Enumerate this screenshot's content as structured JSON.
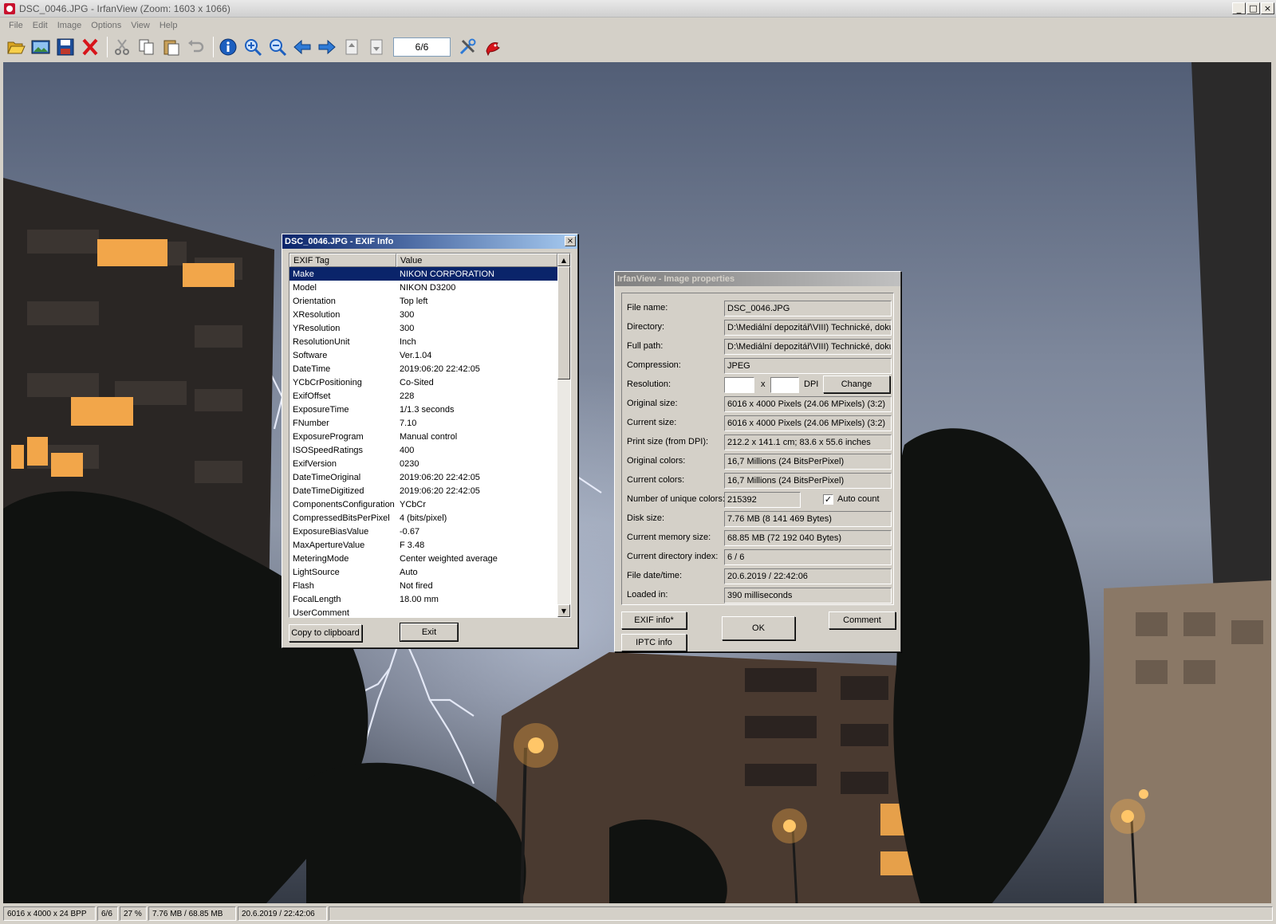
{
  "window": {
    "title": "DSC_0046.JPG - IrfanView (Zoom: 1603 x 1066)",
    "minimize": "_",
    "maximize": "□",
    "close": "×"
  },
  "menu": [
    "File",
    "Edit",
    "Image",
    "Options",
    "View",
    "Help"
  ],
  "toolbar": {
    "counter": "6/6",
    "icons": [
      "open-icon",
      "slideshow-icon",
      "save-icon",
      "delete-icon",
      "cut-icon",
      "copy-icon",
      "paste-icon",
      "undo-icon",
      "info-icon",
      "zoom-in-icon",
      "zoom-out-icon",
      "prev-icon",
      "next-icon",
      "first-page-icon",
      "last-page-icon",
      "settings-icon",
      "irfanview-icon"
    ]
  },
  "status": {
    "image_info": "6016 x 4000 x 24 BPP",
    "index": "6/6",
    "zoom": "27 %",
    "size": "7.76 MB / 68.85 MB",
    "datetime": "20.6.2019 / 22:42:06"
  },
  "exif": {
    "title": "DSC_0046.JPG - EXIF Info",
    "close": "×",
    "col_tag": "EXIF Tag",
    "col_value": "Value",
    "rows": [
      {
        "tag": "Make",
        "value": "NIKON CORPORATION"
      },
      {
        "tag": "Model",
        "value": "NIKON D3200"
      },
      {
        "tag": "Orientation",
        "value": "Top left"
      },
      {
        "tag": "XResolution",
        "value": "300"
      },
      {
        "tag": "YResolution",
        "value": "300"
      },
      {
        "tag": "ResolutionUnit",
        "value": "Inch"
      },
      {
        "tag": "Software",
        "value": "Ver.1.04"
      },
      {
        "tag": "DateTime",
        "value": "2019:06:20 22:42:05"
      },
      {
        "tag": "YCbCrPositioning",
        "value": "Co-Sited"
      },
      {
        "tag": "ExifOffset",
        "value": "228"
      },
      {
        "tag": "ExposureTime",
        "value": "1/1.3 seconds"
      },
      {
        "tag": "FNumber",
        "value": "7.10"
      },
      {
        "tag": "ExposureProgram",
        "value": "Manual control"
      },
      {
        "tag": "ISOSpeedRatings",
        "value": "400"
      },
      {
        "tag": "ExifVersion",
        "value": "0230"
      },
      {
        "tag": "DateTimeOriginal",
        "value": "2019:06:20 22:42:05"
      },
      {
        "tag": "DateTimeDigitized",
        "value": "2019:06:20 22:42:05"
      },
      {
        "tag": "ComponentsConfiguration",
        "value": "YCbCr"
      },
      {
        "tag": "CompressedBitsPerPixel",
        "value": "4 (bits/pixel)"
      },
      {
        "tag": "ExposureBiasValue",
        "value": "-0.67"
      },
      {
        "tag": "MaxApertureValue",
        "value": "F 3.48"
      },
      {
        "tag": "MeteringMode",
        "value": "Center weighted average"
      },
      {
        "tag": "LightSource",
        "value": "Auto"
      },
      {
        "tag": "Flash",
        "value": "Not fired"
      },
      {
        "tag": "FocalLength",
        "value": "18.00 mm"
      },
      {
        "tag": "UserComment",
        "value": ""
      }
    ],
    "copy_button": "Copy to clipboard",
    "exit_button": "Exit",
    "scroll_up": "▲",
    "scroll_down": "▼"
  },
  "props": {
    "title": "IrfanView - Image properties",
    "fields": [
      {
        "label": "File name:",
        "value": "DSC_0046.JPG"
      },
      {
        "label": "Directory:",
        "value": "D:\\Mediální depozitář\\VIII) Technické, doku"
      },
      {
        "label": "Full path:",
        "value": "D:\\Mediální depozitář\\VIII) Technické, doku"
      },
      {
        "label": "Compression:",
        "value": "JPEG"
      },
      {
        "label": "Resolution:",
        "value": ""
      },
      {
        "label": "Original size:",
        "value": "6016 x 4000  Pixels (24.06 MPixels) (3:2)"
      },
      {
        "label": "Current size:",
        "value": "6016 x 4000  Pixels (24.06 MPixels) (3:2)"
      },
      {
        "label": "Print size (from DPI):",
        "value": "212.2 x 141.1 cm; 83.6 x 55.6 inches"
      },
      {
        "label": "Original colors:",
        "value": "16,7 Millions   (24 BitsPerPixel)"
      },
      {
        "label": "Current colors:",
        "value": "16,7 Millions   (24 BitsPerPixel)"
      },
      {
        "label": "Number of unique colors:",
        "value": "215392"
      },
      {
        "label": "Disk size:",
        "value": "7.76 MB (8 141 469 Bytes)"
      },
      {
        "label": "Current memory size:",
        "value": "68.85  MB (72 192 040 Bytes)"
      },
      {
        "label": "Current directory index:",
        "value": "6  /  6"
      },
      {
        "label": "File date/time:",
        "value": "20.6.2019 / 22:42:06"
      },
      {
        "label": "Loaded in:",
        "value": "390 milliseconds"
      }
    ],
    "res_x": "x",
    "res_dpi": "DPI",
    "change_button": "Change",
    "auto_count_label": "Auto count",
    "auto_count_checked": "✓",
    "exif_button": "EXIF info*",
    "iptc_button": "IPTC info",
    "ok_button": "OK",
    "comment_button": "Comment"
  },
  "colors": {
    "title_active": "#0a246a",
    "selection": "#0a246a",
    "face": "#d4d0c8"
  }
}
